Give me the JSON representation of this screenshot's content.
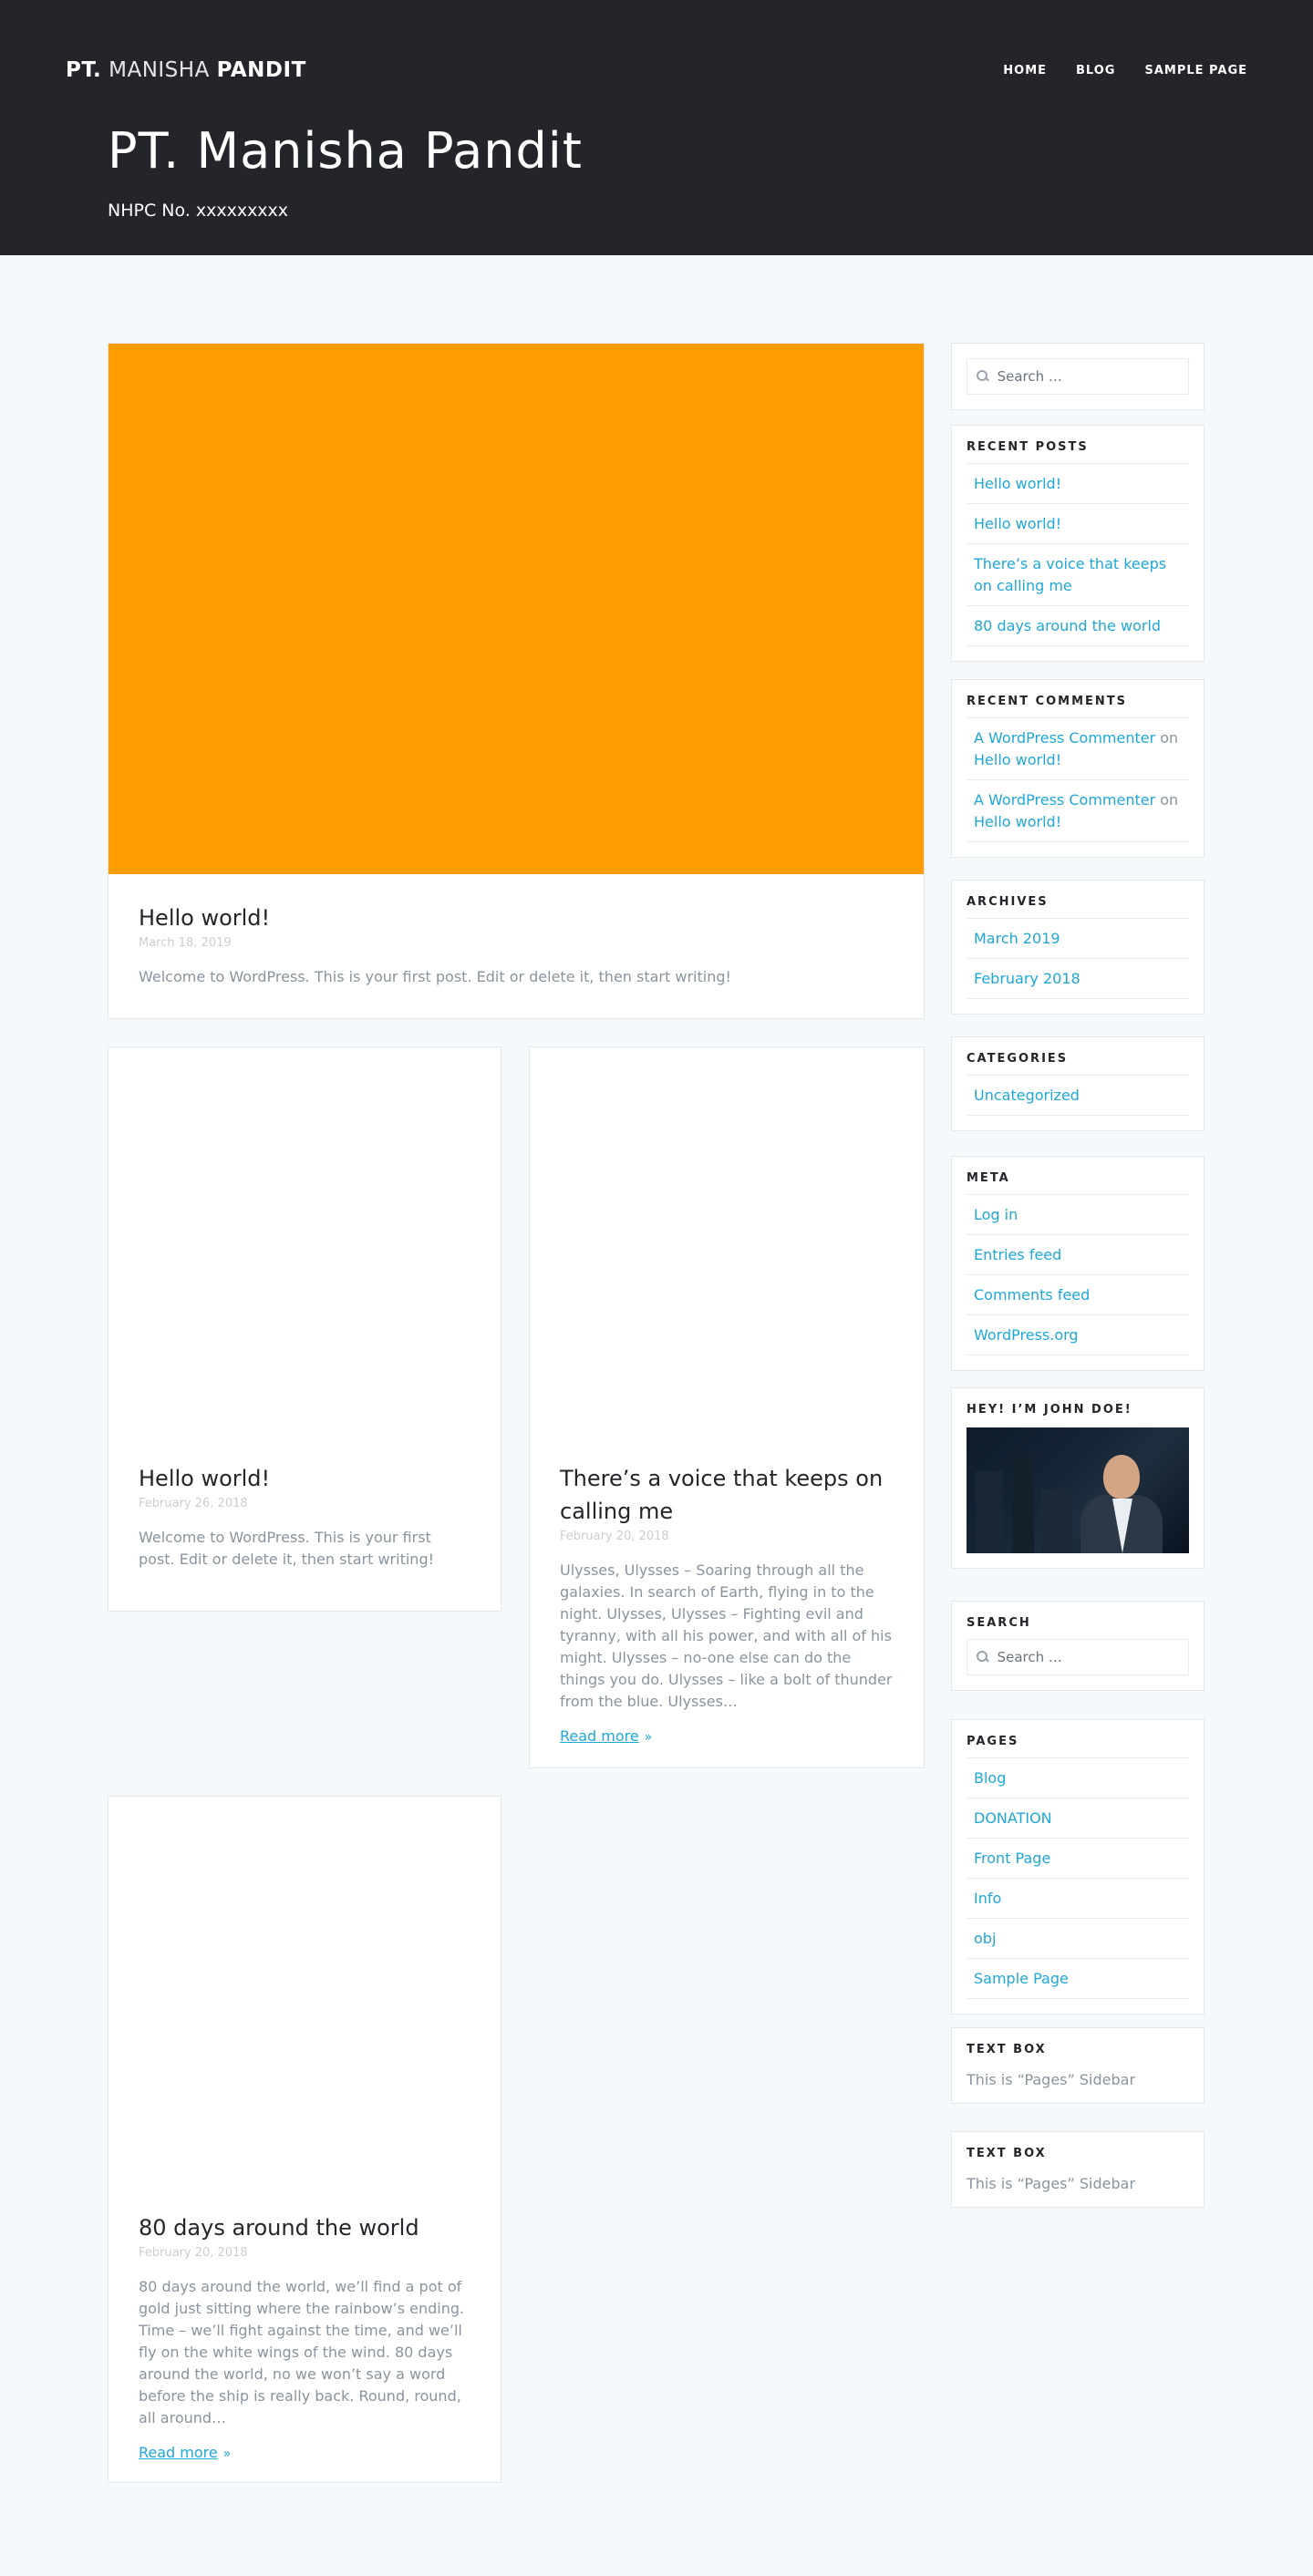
{
  "header": {
    "brand_part1": "PT.",
    "brand_part2": "MANISHA",
    "brand_part3": "PANDIT",
    "nav": [
      "HOME",
      "BLOG",
      "SAMPLE PAGE"
    ],
    "site_title": "PT. Manisha Pandit",
    "site_description": "NHPC No. xxxxxxxxx"
  },
  "colors": {
    "header_bg": "#23252b",
    "featured_image": "#ff9c00",
    "link": "#1ea8d8",
    "page_bg": "#f5f9fc"
  },
  "posts": [
    {
      "title": "Hello world!",
      "date": "March 18, 2019",
      "excerpt": "Welcome to WordPress. This is your first post. Edit or delete it, then start writing!"
    },
    {
      "title": "Hello world!",
      "date": "February 26, 2018",
      "excerpt": "Welcome to WordPress. This is your first post. Edit or delete it, then start writing!"
    },
    {
      "title": "There’s a voice that keeps on calling me",
      "date": "February 20, 2018",
      "excerpt": "Ulysses, Ulysses – Soaring through all the galaxies. In search of Earth, flying in to the night. Ulysses, Ulysses – Fighting evil and tyranny, with all his power, and with all of his might. Ulysses – no-one else can do the things you do. Ulysses – like a bolt of thunder from the blue. Ulysses…",
      "read_more": "Read more"
    },
    {
      "title": "80 days around the world",
      "date": "February 20, 2018",
      "excerpt": "80 days around the world, we’ll find a pot of gold just sitting where the rainbow’s ending. Time – we’ll fight against the time, and we’ll fly on the white wings of the wind. 80 days around the world, no we won’t say a word before the ship is really back. Round, round, all around…",
      "read_more": "Read more"
    }
  ],
  "sidebar": {
    "search_placeholder": "Search …",
    "recent_posts": {
      "title": "RECENT POSTS",
      "items": [
        "Hello world!",
        "Hello world!",
        "There’s a voice that keeps on calling me",
        "80 days around the world"
      ]
    },
    "recent_comments": {
      "title": "RECENT COMMENTS",
      "items": [
        {
          "author": "A WordPress Commenter",
          "on": "on",
          "post": "Hello world!"
        },
        {
          "author": "A WordPress Commenter",
          "on": "on",
          "post": "Hello world!"
        }
      ]
    },
    "archives": {
      "title": "ARCHIVES",
      "items": [
        "March 2019",
        "February 2018"
      ]
    },
    "categories": {
      "title": "CATEGORIES",
      "items": [
        "Uncategorized"
      ]
    },
    "meta": {
      "title": "META",
      "items": [
        "Log in",
        "Entries feed",
        "Comments feed",
        "WordPress.org"
      ]
    },
    "profile": {
      "title": "HEY! I’M JOHN DOE!"
    },
    "search": {
      "title": "SEARCH",
      "placeholder": "Search …"
    },
    "pages": {
      "title": "PAGES",
      "items": [
        "Blog",
        "DONATION",
        "Front Page",
        "Info",
        "obj",
        "Sample Page"
      ]
    },
    "text_box_1": {
      "title": "TEXT BOX",
      "text": "This is “Pages” Sidebar"
    },
    "text_box_2": {
      "title": "TEXT BOX",
      "text": "This is “Pages” Sidebar"
    }
  }
}
